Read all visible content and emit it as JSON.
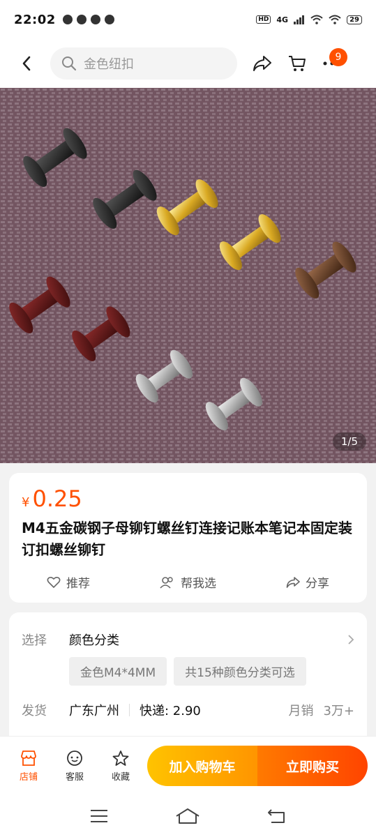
{
  "status_bar": {
    "time": "22:02",
    "network": "4G",
    "battery": "29",
    "hd": "HD"
  },
  "nav": {
    "search_placeholder": "金色纽扣",
    "cart_badge": "9"
  },
  "gallery": {
    "indicator": "1/5"
  },
  "product": {
    "currency": "¥",
    "price": "0.25",
    "title": "M4五金碳钢子母铆钉螺丝钉连接记账本笔记本固定装订扣螺丝铆钉",
    "actions": {
      "recommend": "推荐",
      "help_choose": "帮我选",
      "share": "分享"
    }
  },
  "options": {
    "select_label": "选择",
    "select_value": "颜色分类",
    "chips": [
      "金色M4*4MM",
      "共15种颜色分类可选"
    ],
    "ship_label": "发货",
    "ship_location": "广东广州",
    "ship_express": "快递: 2.90",
    "sales_label": "月销",
    "sales_value": "3万+"
  },
  "bottom_bar": {
    "store": "店铺",
    "service": "客服",
    "favorite": "收藏",
    "add_to_cart": "加入购物车",
    "buy_now": "立即购买"
  },
  "colors": {
    "accent": "#ff5000",
    "cart_btn": "#ffb000",
    "buy_btn": "#ff5a00"
  }
}
